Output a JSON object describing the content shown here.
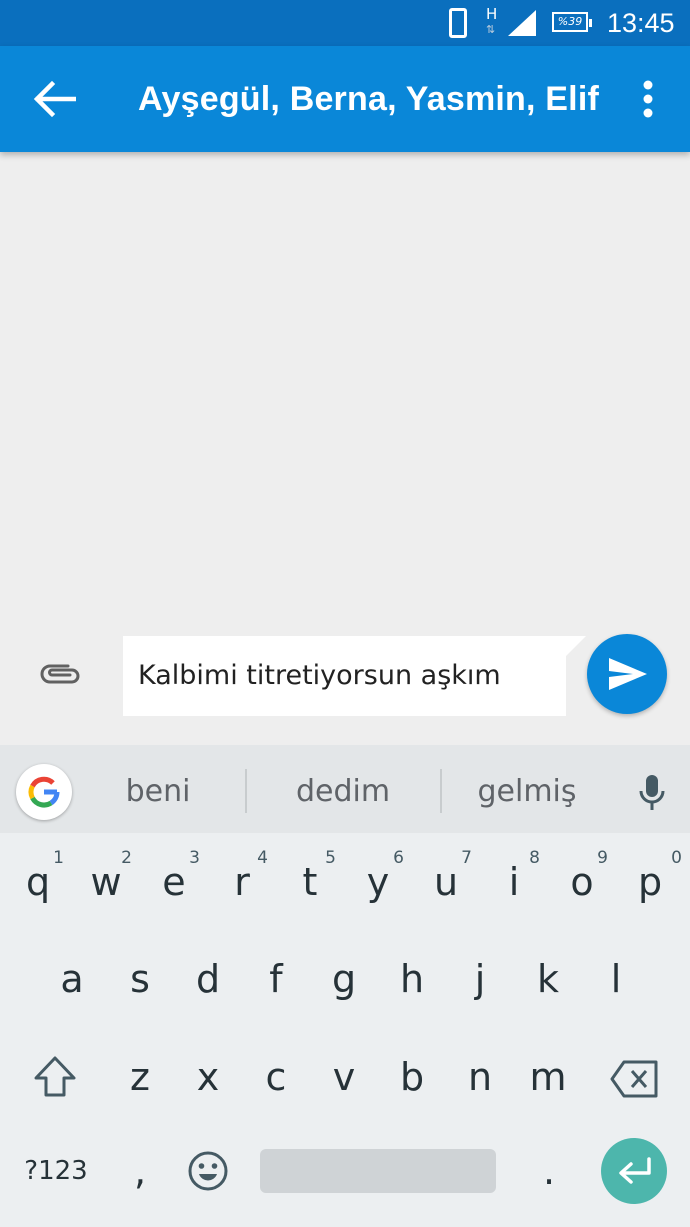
{
  "status_bar": {
    "network_type": "H",
    "battery": "%39",
    "time": "13:45"
  },
  "app_bar": {
    "title": "Ayşegül, Berna, Yasmin, Elif"
  },
  "composer": {
    "message_text": "Kalbimi titretiyorsun aşkım"
  },
  "keyboard": {
    "suggestions": [
      "beni",
      "dedim",
      "gelmiş"
    ],
    "row1": [
      {
        "key": "q",
        "num": "1"
      },
      {
        "key": "w",
        "num": "2"
      },
      {
        "key": "e",
        "num": "3"
      },
      {
        "key": "r",
        "num": "4"
      },
      {
        "key": "t",
        "num": "5"
      },
      {
        "key": "y",
        "num": "6"
      },
      {
        "key": "u",
        "num": "7"
      },
      {
        "key": "i",
        "num": "8"
      },
      {
        "key": "o",
        "num": "9"
      },
      {
        "key": "p",
        "num": "0"
      }
    ],
    "row2": [
      "a",
      "s",
      "d",
      "f",
      "g",
      "h",
      "j",
      "k",
      "l"
    ],
    "row3": [
      "z",
      "x",
      "c",
      "v",
      "b",
      "n",
      "m"
    ],
    "symbols_label": "?123",
    "comma": ",",
    "period": "."
  },
  "colors": {
    "status_bar": "#0a6fbe",
    "app_bar": "#0a87d8",
    "send_button": "#0a87d8",
    "enter_key": "#4db6ac"
  }
}
